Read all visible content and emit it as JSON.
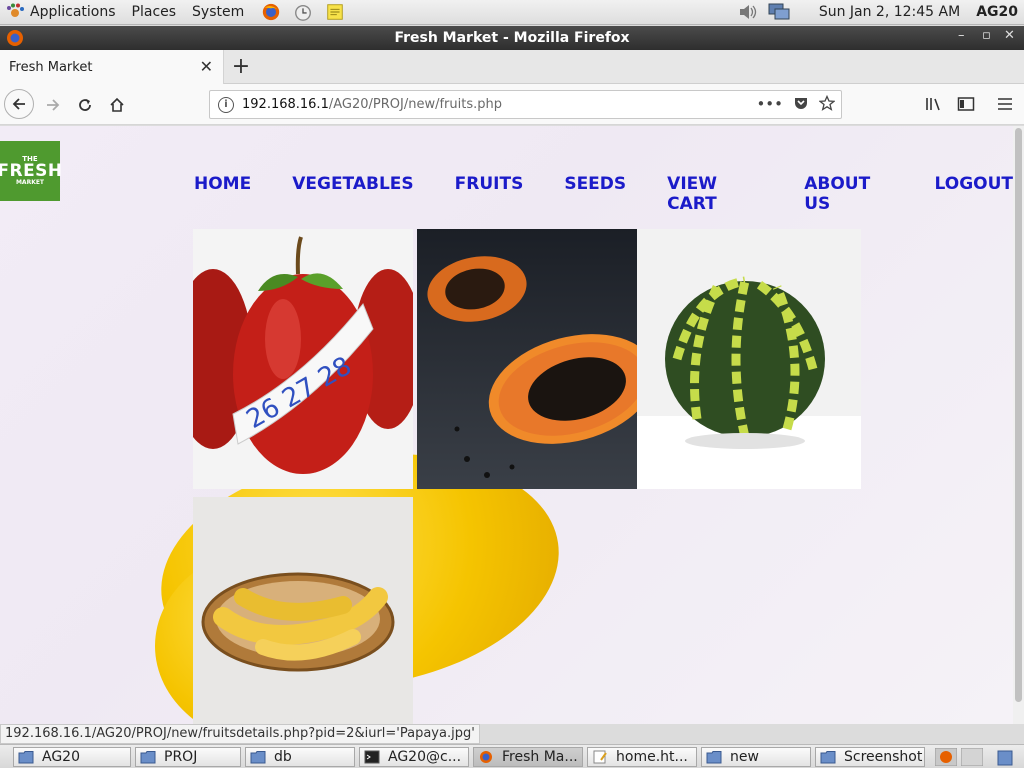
{
  "panel": {
    "menus": [
      "Applications",
      "Places",
      "System"
    ],
    "clock": "Sun Jan  2, 12:45 AM",
    "user": "AG20"
  },
  "window": {
    "title": "Fresh Market - Mozilla Firefox"
  },
  "browser": {
    "tab_title": "Fresh Market",
    "url_host": "192.168.16.1",
    "url_path": "/AG20/PROJ/new/fruits.php",
    "status_url": "192.168.16.1/AG20/PROJ/new/fruitsdetails.php?pid=2&iurl='Papaya.jpg'"
  },
  "site": {
    "logo": {
      "line1": "THE",
      "line2": "FRESH",
      "line3": "MARKET"
    },
    "nav": [
      "HOME",
      "VEGETABLES",
      "FRUITS",
      "SEEDS",
      "VIEW CART",
      "ABOUT US",
      "LOGOUT"
    ],
    "nav_color": "#1b1bc9",
    "products": [
      {
        "name": "Apple",
        "icon": "apple-with-measuring-tape"
      },
      {
        "name": "Papaya",
        "icon": "papaya-halves"
      },
      {
        "name": "Watermelon",
        "icon": "watermelon"
      },
      {
        "name": "Banana",
        "icon": "bananas-in-basket"
      }
    ]
  },
  "taskbar": {
    "items": [
      {
        "label": "AG20",
        "icon": "folder-icon"
      },
      {
        "label": "PROJ",
        "icon": "folder-icon"
      },
      {
        "label": "db",
        "icon": "folder-icon"
      },
      {
        "label": "AG20@c...",
        "icon": "terminal-icon"
      },
      {
        "label": "Fresh Ma...",
        "icon": "firefox-icon"
      },
      {
        "label": "home.ht...",
        "icon": "text-editor-icon"
      },
      {
        "label": "new",
        "icon": "folder-icon"
      },
      {
        "label": "Screenshot",
        "icon": "folder-icon"
      }
    ]
  }
}
